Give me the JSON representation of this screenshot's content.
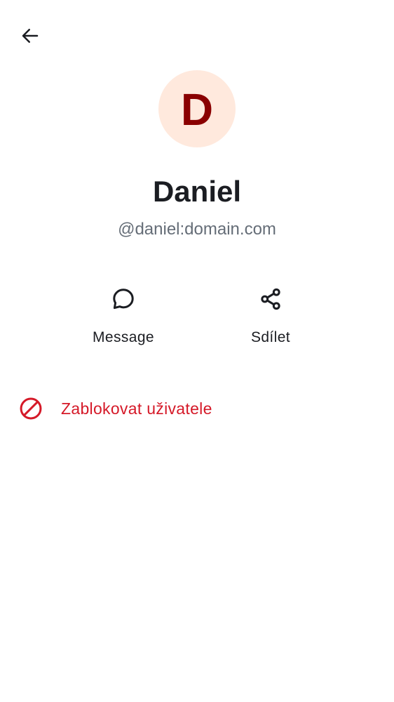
{
  "header": {
    "back_icon": "arrow-left-icon"
  },
  "profile": {
    "avatar_letter": "D",
    "display_name": "Daniel",
    "user_id": "@daniel:domain.com"
  },
  "actions": [
    {
      "label": "Message",
      "icon": "chat-bubble-icon"
    },
    {
      "label": "Sdílet",
      "icon": "share-icon"
    }
  ],
  "danger": {
    "block_label": "Zablokovat uživatele",
    "icon": "block-icon"
  },
  "colors": {
    "avatar_bg": "#ffe9dd",
    "avatar_letter": "#8a0000",
    "primary_text": "#1b1d22",
    "secondary_text": "#656d77",
    "danger": "#d51928",
    "background": "#ffffff"
  }
}
